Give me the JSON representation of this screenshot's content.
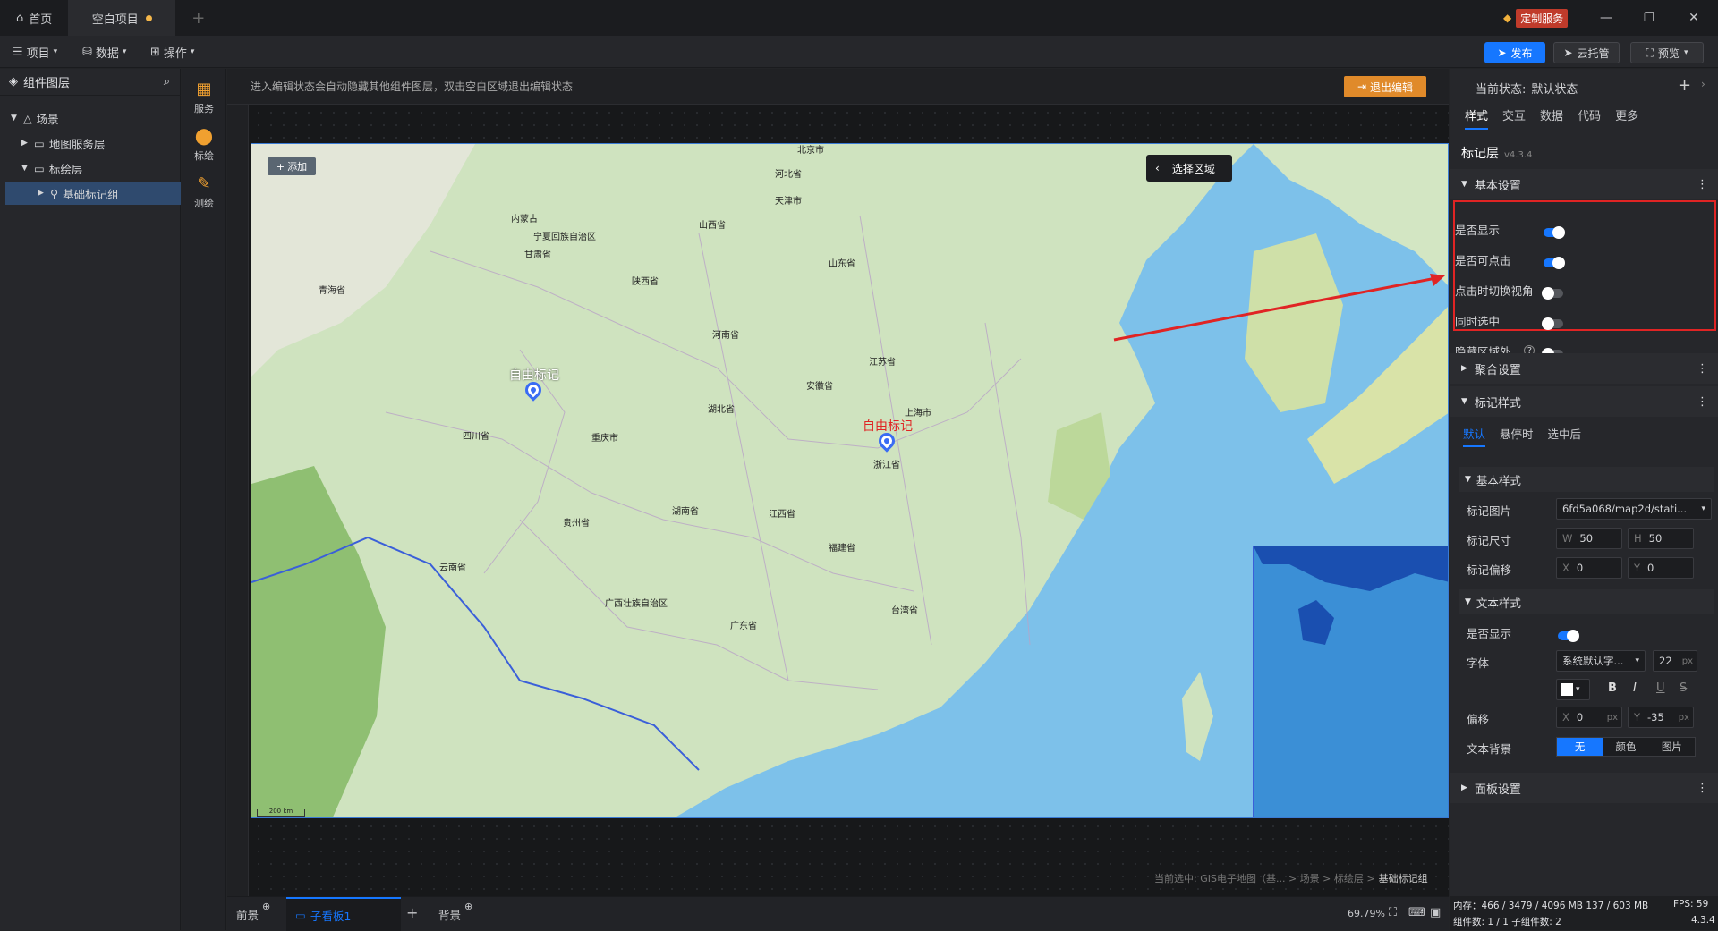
{
  "titlebar": {
    "home_tab": "首页",
    "project_tab": "空白项目",
    "custom_service": "定制服务"
  },
  "menubar": {
    "project": "项目",
    "data": "数据",
    "operate": "操作",
    "publish": "发布",
    "cloud": "云托管",
    "preview": "预览"
  },
  "left": {
    "title": "组件图层",
    "tree": [
      {
        "label": "场景",
        "icon": "scene-icon"
      },
      {
        "label": "地图服务层",
        "icon": "folder-icon"
      },
      {
        "label": "标绘层",
        "icon": "folder-icon"
      },
      {
        "label": "基础标记组",
        "icon": "marker-group-icon"
      }
    ]
  },
  "iconbar": [
    {
      "label": "服务"
    },
    {
      "label": "标绘"
    },
    {
      "label": "测绘"
    }
  ],
  "canvas": {
    "edit_notice": "进入编辑状态会自动隐藏其他组件图层，双击空白区域退出编辑状态",
    "exit_edit": "退出编辑",
    "add_button": "添加",
    "select_area": "选择区域",
    "marker1": "自由标记",
    "marker2": "自由标记",
    "places": [
      "北京市",
      "天津市",
      "河北省",
      "山西省",
      "内蒙古",
      "宁夏回族自治区",
      "陕西省",
      "青海省",
      "甘肃省",
      "山东省",
      "河南省",
      "江苏省",
      "安徽省",
      "上海市",
      "湖北省",
      "四川省",
      "重庆市",
      "浙江省",
      "湖南省",
      "江西省",
      "贵州省",
      "福建省",
      "云南省",
      "广西壮族自治区",
      "广东省",
      "台湾省"
    ],
    "scale_label": "200 km",
    "breadcrumb_prefix": "当前选中: GIS电子地图（基... > 场景 > 标绘层 >",
    "breadcrumb_current": "基础标记组"
  },
  "right": {
    "state_label": "当前状态:",
    "state_value": "默认状态",
    "tabs": [
      "样式",
      "交互",
      "数据",
      "代码",
      "更多"
    ],
    "layer_title": "标记层",
    "version": "v4.3.4",
    "basic_settings": "基本设置",
    "basic_rows": [
      {
        "label": "是否显示",
        "on": true
      },
      {
        "label": "是否可点击",
        "on": true
      },
      {
        "label": "点击时切换视角",
        "on": false
      },
      {
        "label": "同时选中",
        "on": false
      },
      {
        "label": "隐藏区域外...",
        "on": false
      }
    ],
    "aggregate": "聚合设置",
    "marker_style": "标记样式",
    "style_tabs": [
      "默认",
      "悬停时",
      "选中后"
    ],
    "basic_style": "基本样式",
    "marker_image_label": "标记图片",
    "marker_image_value": "6fd5a068/map2d/stati...",
    "marker_size_label": "标记尺寸",
    "w": "50",
    "h": "50",
    "marker_offset_label": "标记偏移",
    "ox": "0",
    "oy": "0",
    "text_style": "文本样式",
    "text_show_label": "是否显示",
    "font_label": "字体",
    "font_value": "系统默认字...",
    "font_size": "22",
    "px": "px",
    "offset_label": "偏移",
    "tx": "0",
    "ty": "-35",
    "text_bg_label": "文本背景",
    "bg_options": [
      "无",
      "颜色",
      "图片"
    ],
    "panel_settings": "面板设置"
  },
  "bottom": {
    "foreground": "前景",
    "subboard": "子看板1",
    "background": "背景",
    "zoom": "69.79%"
  },
  "status": {
    "memory": "内存：466 / 3479 / 4096 MB  137 / 603 MB",
    "fps": "FPS: 59",
    "components": "组件数: 1 / 1    子组件数: 2",
    "version": "4.3.4"
  },
  "colors": {
    "accent": "#1677ff",
    "highlight": "#e02424",
    "marker": "#3a6cf4"
  }
}
